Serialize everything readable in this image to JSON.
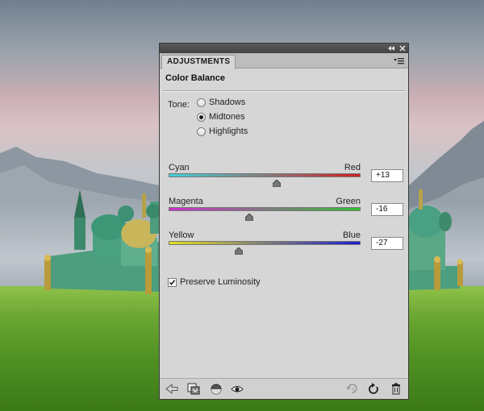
{
  "panel": {
    "tab_label": "ADJUSTMENTS",
    "title": "Color Balance",
    "tone": {
      "label": "Tone:",
      "options": [
        {
          "label": "Shadows",
          "selected": false
        },
        {
          "label": "Midtones",
          "selected": true
        },
        {
          "label": "Highlights",
          "selected": false
        }
      ]
    },
    "sliders": [
      {
        "left_label": "Cyan",
        "right_label": "Red",
        "value": "+13",
        "numeric": 13,
        "range": [
          -100,
          100
        ],
        "gradient": [
          "#3fd3d8",
          "#d02020"
        ]
      },
      {
        "left_label": "Magenta",
        "right_label": "Green",
        "value": "-16",
        "numeric": -16,
        "range": [
          -100,
          100
        ],
        "gradient": [
          "#d030d0",
          "#30c030"
        ]
      },
      {
        "left_label": "Yellow",
        "right_label": "Blue",
        "value": "-27",
        "numeric": -27,
        "range": [
          -100,
          100
        ],
        "gradient": [
          "#e4e020",
          "#1b1bd0"
        ]
      }
    ],
    "preserve_luminosity": {
      "label": "Preserve Luminosity",
      "checked": true
    }
  },
  "icons": {
    "collapse": "double-chevron-left-icon",
    "close": "close-icon",
    "menu": "panel-menu-icon",
    "bottom_left": [
      "back-arrow-icon",
      "clip-to-layer-icon",
      "layer-visibility-mask-icon",
      "eye-icon"
    ],
    "bottom_right": [
      "previous-state-icon",
      "reset-icon",
      "trash-icon"
    ]
  }
}
